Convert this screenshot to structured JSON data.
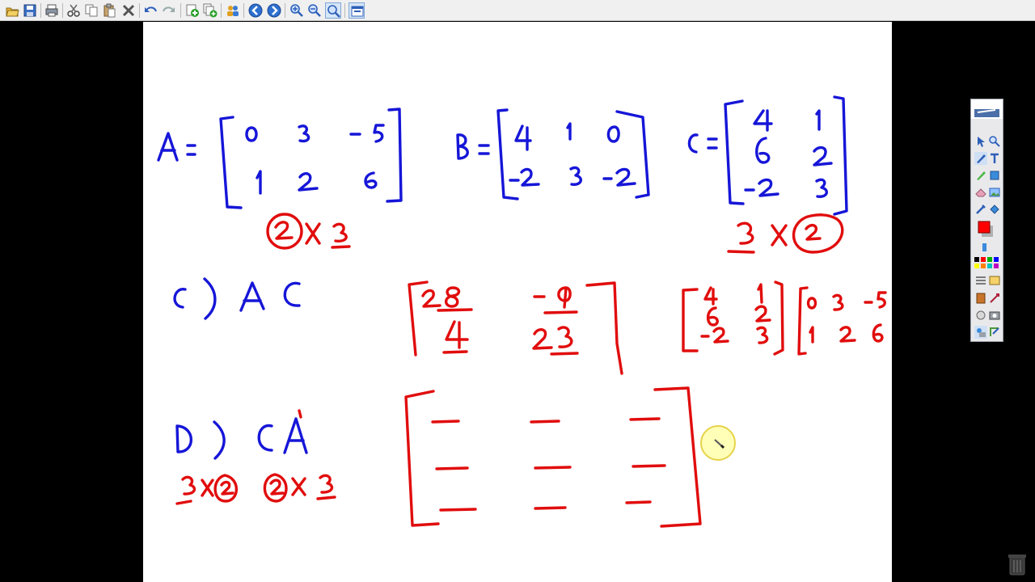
{
  "toolbar": {
    "buttons": [
      "open-icon",
      "save-icon",
      "print-icon",
      "cut-icon",
      "copy-icon",
      "paste-icon",
      "delete-icon",
      "undo-icon",
      "redo-icon",
      "add-page-icon",
      "duplicate-page-icon",
      "users-icon",
      "back-icon",
      "forward-icon",
      "zoom-in-icon",
      "zoom-out-icon",
      "zoom-fit-icon",
      "window-icon"
    ]
  },
  "colors": {
    "blue_ink": "#1616d8",
    "red_ink": "#e10d0d",
    "canvas": "#ffffff",
    "background": "#000000"
  },
  "side_palette": {
    "tools": [
      "pointer-tool-icon",
      "zoom-tool-icon",
      "pen-tool-icon",
      "text-tool-icon",
      "highlighter-tool-icon",
      "shape-tool-icon",
      "eraser-tool-icon",
      "image-tool-icon",
      "pipette-tool-icon",
      "fill-tool-icon",
      "line-style-icon",
      "settings-icon",
      "record-icon",
      "magic-pen-icon",
      "screen-capture-icon",
      "camera-icon",
      "media-icon",
      "export-icon"
    ],
    "selected_color": "#ff0000",
    "colors": [
      "#000000",
      "#ff0000",
      "#00b000",
      "#0000ff",
      "#ffff00",
      "#ff8000",
      "#00c0c0",
      "#c000c0"
    ]
  }
}
